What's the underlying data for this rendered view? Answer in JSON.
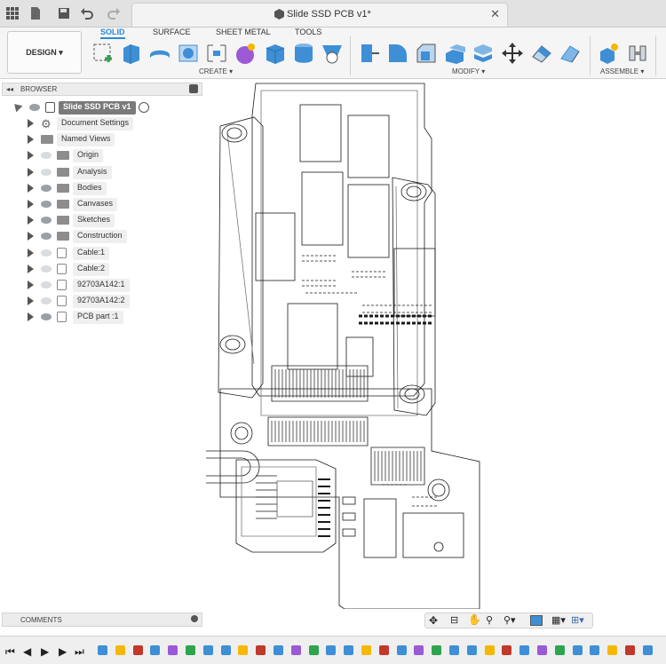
{
  "document_title": "Slide SSD PCB v1*",
  "ribbon": {
    "workspace": "DESIGN",
    "tabs": [
      "SOLID",
      "SURFACE",
      "SHEET METAL",
      "TOOLS"
    ],
    "active_tab": "SOLID",
    "groups": [
      "CREATE",
      "MODIFY",
      "ASSEMBLE"
    ]
  },
  "browser": {
    "title": "BROWSER",
    "root": "Slide SSD PCB v1",
    "items": [
      {
        "label": "Document Settings",
        "icon": "gear-icon",
        "visible": null
      },
      {
        "label": "Named Views",
        "icon": "folder-icon",
        "visible": null
      },
      {
        "label": "Origin",
        "icon": "folder-icon",
        "visible": false
      },
      {
        "label": "Analysis",
        "icon": "folder-icon",
        "visible": false
      },
      {
        "label": "Bodies",
        "icon": "folder-icon",
        "visible": true
      },
      {
        "label": "Canvases",
        "icon": "folder-icon",
        "visible": true
      },
      {
        "label": "Sketches",
        "icon": "folder-icon",
        "visible": true
      },
      {
        "label": "Construction",
        "icon": "folder-icon",
        "visible": true
      },
      {
        "label": "Cable:1",
        "icon": "component-icon",
        "visible": false
      },
      {
        "label": "Cable:2",
        "icon": "component-icon",
        "visible": false
      },
      {
        "label": "92703A142:1",
        "icon": "component-icon",
        "visible": false
      },
      {
        "label": "92703A142:2",
        "icon": "component-icon",
        "visible": false
      },
      {
        "label": "PCB part :1",
        "icon": "component-icon",
        "visible": true
      }
    ]
  },
  "comments_label": "COMMENTS",
  "colors": {
    "accent": "#2a8ad8",
    "folder": "#8d8d8d",
    "line": "#1a1a1a"
  }
}
